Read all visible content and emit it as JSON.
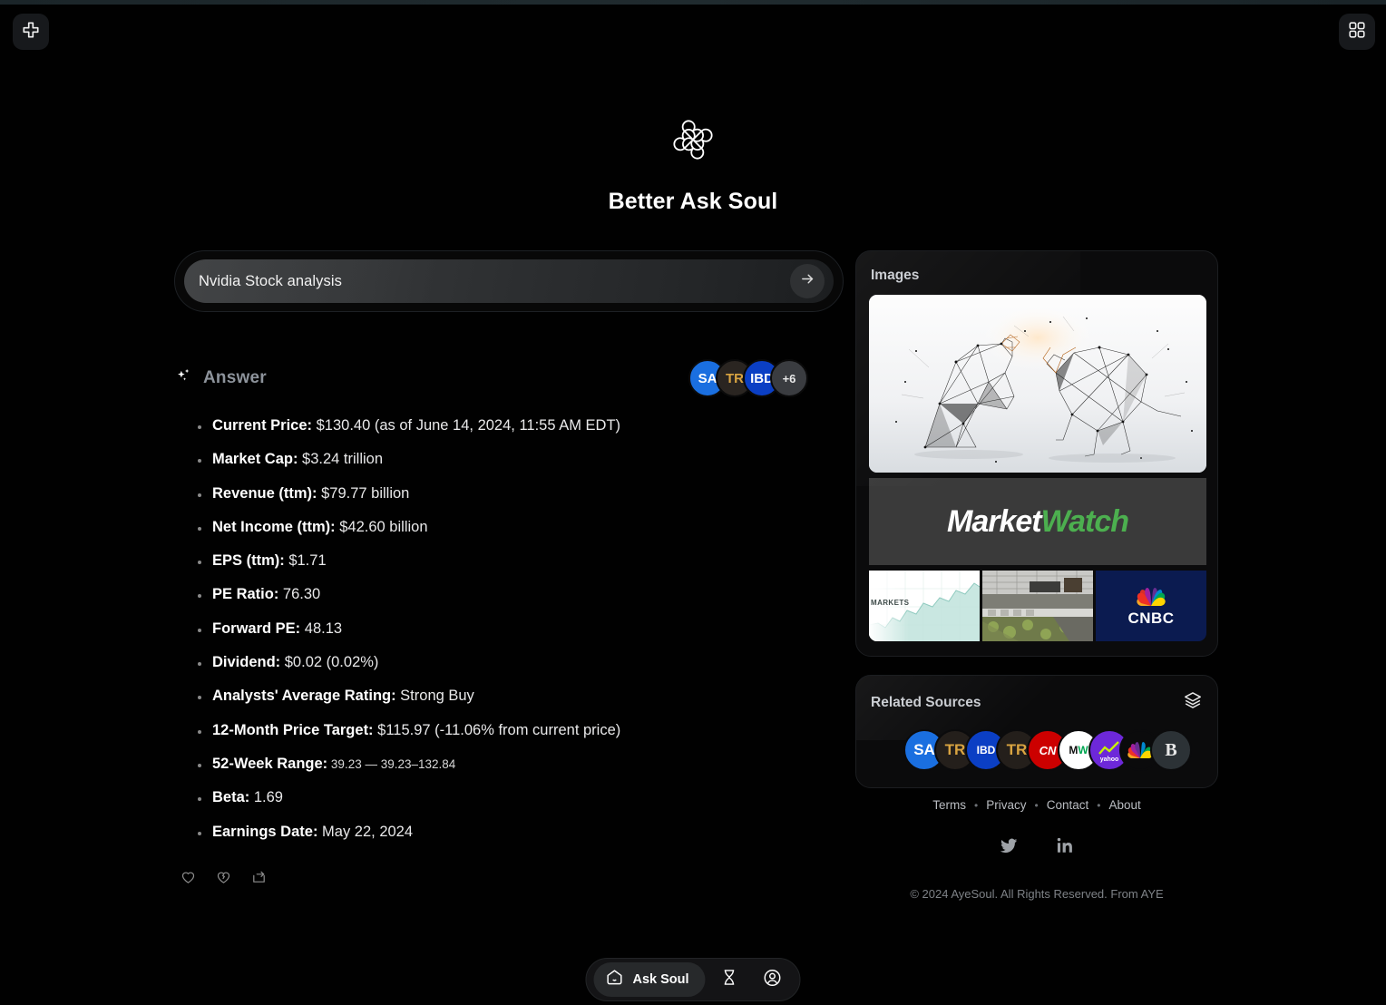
{
  "brand": {
    "title": "Better Ask Soul",
    "logo_icon": "clover-pinwheel-logo"
  },
  "topbar": {
    "add_icon": "plus-icon",
    "apps_icon": "grid-apps-icon"
  },
  "search": {
    "query": "Nvidia Stock analysis",
    "submit_icon": "arrow-right-icon"
  },
  "answer": {
    "label": "Answer",
    "sparkle_icon": "sparkles-icon",
    "source_avatars": [
      {
        "short": "SA",
        "bg": "#1a6fe0",
        "fg": "#ffffff"
      },
      {
        "short": "TR",
        "bg": "#2a2521",
        "fg": "#d9a441"
      },
      {
        "short": "IBD",
        "bg": "#0b3fc4",
        "fg": "#ffffff"
      }
    ],
    "more_count": "+6",
    "bullets": [
      {
        "label": "Current Price:",
        "value": "$130.40 (as of June 14, 2024, 11:55 AM EDT)"
      },
      {
        "label": "Market Cap:",
        "value": "$3.24 trillion"
      },
      {
        "label": "Revenue (ttm):",
        "value": "$79.77 billion"
      },
      {
        "label": "Net Income (ttm):",
        "value": "$42.60 billion"
      },
      {
        "label": "EPS (ttm):",
        "value": "$1.71"
      },
      {
        "label": "PE Ratio:",
        "value": "76.30"
      },
      {
        "label": "Forward PE:",
        "value": "48.13"
      },
      {
        "label": "Dividend:",
        "value": "$0.02 (0.02%)"
      },
      {
        "label": "Analysts' Average Rating:",
        "value": "Strong Buy"
      },
      {
        "label": "12-Month Price Target:",
        "value": "$115.97 (-11.06% from current price)"
      },
      {
        "label": "52-Week Range:",
        "value": "39.23 — 39.23–132.84",
        "small": true
      },
      {
        "label": "Beta:",
        "value": "1.69"
      },
      {
        "label": "Earnings Date:",
        "value": "May 22, 2024"
      }
    ],
    "reactions": [
      {
        "icon": "heart-icon",
        "name": "like-button"
      },
      {
        "icon": "broken-heart-icon",
        "name": "dislike-button"
      },
      {
        "icon": "share-icon",
        "name": "share-button"
      }
    ]
  },
  "images_panel": {
    "title": "Images",
    "hero_alt": "bull-and-bear-wireframe",
    "banner_text_a": "Market",
    "banner_text_b": "Watch",
    "thumbs": [
      {
        "name": "markets-chart-thumbnail",
        "label": "MARKETS"
      },
      {
        "name": "aerial-rooftop-thumbnail",
        "label": ""
      },
      {
        "name": "cnbc-thumbnail",
        "label": "CNBC"
      }
    ]
  },
  "sources_panel": {
    "title": "Related Sources",
    "layers_icon": "layers-icon",
    "sources": [
      {
        "short": "SA",
        "bg": "#1a6fe0",
        "fg": "#ffffff"
      },
      {
        "short": "TR",
        "bg": "#241f1b",
        "fg": "#d9a441"
      },
      {
        "short": "IBD",
        "bg": "#0b3fc4",
        "fg": "#ffffff"
      },
      {
        "short": "TR",
        "bg": "#241f1b",
        "fg": "#d9a441"
      },
      {
        "short": "CNN",
        "bg": "#cc0000",
        "fg": "#ffffff"
      },
      {
        "short": "MW",
        "bg": "#ffffff",
        "fg": "#111111"
      },
      {
        "short": "yahoo",
        "bg": "#6d28d9",
        "fg": "#ffffff"
      },
      {
        "short": "NBC",
        "bg": "#0b0b0c",
        "fg": "#ffffff"
      },
      {
        "short": "B",
        "bg": "#2c3236",
        "fg": "#e8e8e8"
      }
    ]
  },
  "footer": {
    "links": [
      "Terms",
      "Privacy",
      "Contact",
      "About"
    ],
    "separator": "•",
    "social": [
      {
        "name": "twitter-icon"
      },
      {
        "name": "linkedin-icon"
      }
    ],
    "copyright": "© 2024 AyeSoul. All Rights Reserved. From AYE"
  },
  "bottom_nav": {
    "ask_label": "Ask Soul",
    "ask_icon": "soul-pentagon-icon",
    "history_icon": "hourglass-icon",
    "profile_icon": "user-circle-icon"
  }
}
